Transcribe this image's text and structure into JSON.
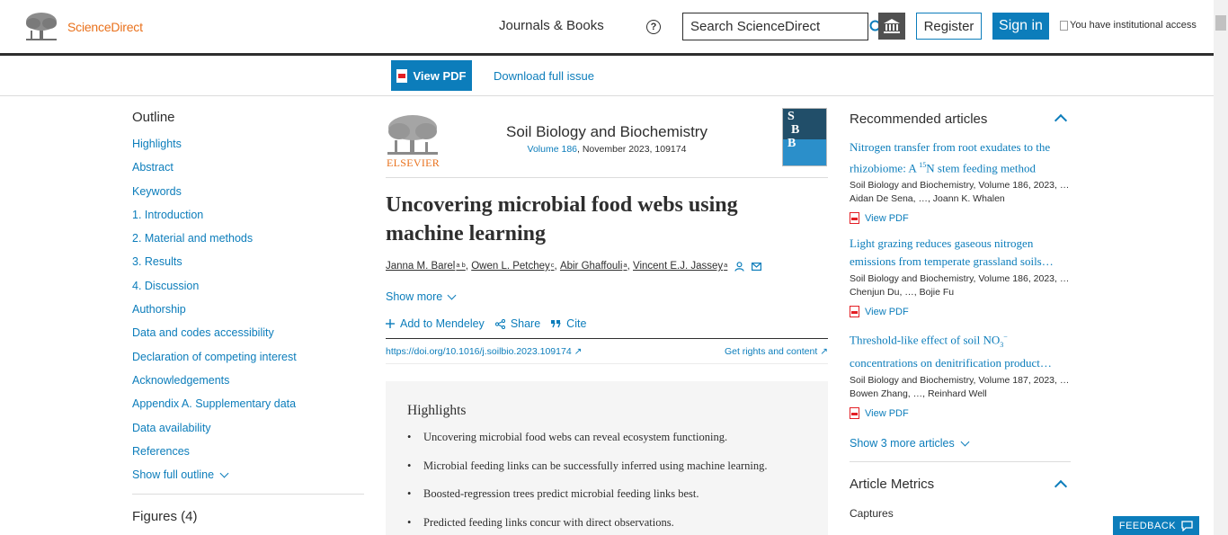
{
  "header": {
    "logo_text": "ScienceDirect",
    "journals_books": "Journals & Books",
    "help_glyph": "?",
    "search_placeholder": "Search ScienceDirect",
    "register": "Register",
    "sign_in": "Sign in",
    "institutional_access": "You have institutional access"
  },
  "subbar": {
    "view_pdf": "View PDF",
    "download_issue": "Download full issue"
  },
  "outline": {
    "title": "Outline",
    "items": [
      "Highlights",
      "Abstract",
      "Keywords",
      "1. Introduction",
      "2. Material and methods",
      "3. Results",
      "4. Discussion",
      "Authorship",
      "Data and codes accessibility",
      "Declaration of competing interest",
      "Acknowledgements",
      "Appendix A. Supplementary data",
      "Data availability",
      "References"
    ],
    "show_full": "Show full outline",
    "figures": "Figures (4)"
  },
  "article": {
    "publisher": "ELSEVIER",
    "journal": "Soil Biology and Biochemistry",
    "volume": "Volume 186",
    "date_id": ", November 2023, 109174",
    "cover_letters": [
      "S",
      "B",
      "B"
    ],
    "title": "Uncovering microbial food webs using machine learning",
    "authors": [
      {
        "name": "Janna M. Barel",
        "aff": "a b",
        "sep": ", "
      },
      {
        "name": "Owen L. Petchey",
        "aff": "c",
        "sep": ", "
      },
      {
        "name": "Abir Ghaffouli",
        "aff": "a",
        "sep": ", "
      },
      {
        "name": "Vincent E.J. Jassey",
        "aff": "a",
        "sep": ""
      }
    ],
    "show_more": "Show more",
    "actions": {
      "add_mendeley": "Add to Mendeley",
      "share": "Share",
      "cite": "Cite"
    },
    "doi": "https://doi.org/10.1016/j.soilbio.2023.109174",
    "rights": "Get rights and content",
    "highlights_title": "Highlights",
    "highlights": [
      "Uncovering microbial food webs can reveal ecosystem functioning.",
      "Microbial feeding links can be successfully inferred using machine learning.",
      "Boosted-regression trees predict microbial feeding links best.",
      "Predicted feeding links concur with direct observations."
    ]
  },
  "recommended": {
    "title": "Recommended articles",
    "items": [
      {
        "title_line1": "Nitrogen transfer from root exudates to the",
        "title_line2_pre": "rhizobiome: A ",
        "title_line2_sup": "15",
        "title_line2_post": "N stem feeding method",
        "meta": "Soil Biology and Biochemistry, Volume 186, 2023, …",
        "authors": "Aidan De Sena, …, Joann K. Whalen",
        "pdf": "View PDF"
      },
      {
        "title_line1": "Light grazing reduces gaseous nitrogen",
        "title_line2_pre": "emissions from temperate grassland soils…",
        "title_line2_sup": "",
        "title_line2_post": "",
        "meta": "Soil Biology and Biochemistry, Volume 186, 2023, …",
        "authors": "Chenjun Du, …, Bojie Fu",
        "pdf": "View PDF"
      },
      {
        "title_line1_pre": "Threshold-like effect of soil NO",
        "title_line1_sub": "3",
        "title_line1_sup": "−",
        "title_line2_pre": "concentrations on denitrification product…",
        "title_line2_sup": "",
        "title_line2_post": "",
        "meta": "Soil Biology and Biochemistry, Volume 187, 2023, …",
        "authors": "Bowen Zhang, …, Reinhard Well",
        "pdf": "View PDF"
      }
    ],
    "show_more": "Show 3 more articles"
  },
  "metrics": {
    "title": "Article Metrics",
    "captures": "Captures"
  },
  "feedback": "FEEDBACK",
  "colors": {
    "accent": "#0c7dbb",
    "brand_orange": "#e9711c",
    "pdf_red": "#e31e24"
  }
}
